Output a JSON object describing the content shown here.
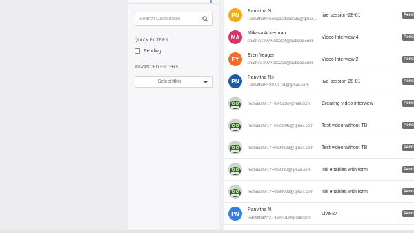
{
  "filters": {
    "search_placeholder": "Search Candidates",
    "quick_filters_label": "QUICK FILTERS",
    "pending_label": "Pending",
    "advanced_filters_label": "ADVANCED FILTERS",
    "select_filter_label": "Select filter"
  },
  "candidates": [
    {
      "initials": "PN",
      "avatar_color": "#f5a623",
      "name": "Panvitha N",
      "email": "PanvithaN+newcandidate29@gmail...",
      "interview": "live session-28-01",
      "status": "Pend"
    },
    {
      "initials": "MA",
      "avatar_color": "#d6336c",
      "name": "Mikasa Ackerman",
      "email": "shidhin1997+020304@outlook.com",
      "interview": "Video Interview 4",
      "status": "Pend"
    },
    {
      "initials": "EY",
      "avatar_color": "#ef6c2e",
      "name": "Eren Yeager",
      "email": "shidhin1997+010203@outlook.com",
      "interview": "Video Interview 2",
      "status": "Pend"
    },
    {
      "initials": "PN",
      "avatar_color": "#1e5aa8",
      "name": "Panvitha Ns",
      "email": "PanvithaN+29-01-01@gmail.com",
      "interview": "live session-28-01",
      "status": "Pend"
    },
    {
      "initials": "",
      "avatar_color": "",
      "name": "",
      "email": "mohdashir17+09-923@gmail.com",
      "interview": "Creating video interview",
      "status": "Pend"
    },
    {
      "initials": "",
      "avatar_color": "",
      "name": "",
      "email": "mohdashir17+0223342@gmail.com",
      "interview": "Test video without TBI",
      "status": "Pend"
    },
    {
      "initials": "",
      "avatar_color": "",
      "name": "",
      "email": "mohdashir17+0809823@gmail.com",
      "interview": "Test video without TBI",
      "status": "Pend"
    },
    {
      "initials": "",
      "avatar_color": "",
      "name": "",
      "email": "mohdashir17+092232@gmail.com",
      "interview": "Tbi enabled with form",
      "status": "Pend"
    },
    {
      "initials": "",
      "avatar_color": "",
      "name": "",
      "email": "mohdashir17+0989023@gmail.com",
      "interview": "Tbi enabled with form",
      "status": "Pend"
    },
    {
      "initials": "PN",
      "avatar_color": "#3b7ddd",
      "name": "Panvitha N",
      "email": "PanvithaN+27-can-01@gmail.com",
      "interview": "Live-27",
      "status": "Pend"
    }
  ]
}
